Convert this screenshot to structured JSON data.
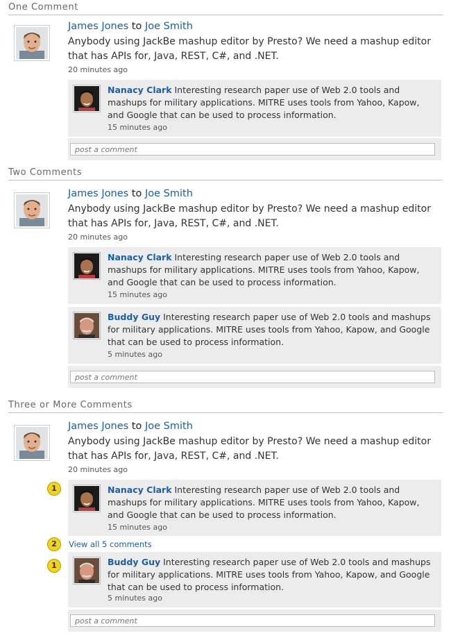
{
  "sections": [
    {
      "title": "One Comment"
    },
    {
      "title": "Two Comments"
    },
    {
      "title": "Three or More Comments"
    }
  ],
  "post": {
    "author": "James Jones",
    "to_word": "to",
    "recipient": "Joe Smith",
    "text": "Anybody using JackBe mashup editor by Presto? We need a mashup editor that has APIs for, Java, REST, C#, and .NET.",
    "time": "20 minutes ago"
  },
  "comments": {
    "nanacy": {
      "name": "Nanacy Clark",
      "text": "Interesting research paper use of Web 2.0 tools and mashups for military applications. MITRE uses tools from Yahoo, Kapow, and Google that can be used to process information.",
      "time": "15 minutes ago"
    },
    "buddy": {
      "name": "Buddy Guy",
      "text": "Interesting research paper use of Web 2.0 tools and mashups for military applications. MITRE uses tools from Yahoo, Kapow, and Google that can be used to process information.",
      "time": "5 minutes ago"
    }
  },
  "comment_box": {
    "placeholder": "post a comment"
  },
  "view_all": "View all 5 comments",
  "markers": {
    "one": "1",
    "two": "2"
  },
  "colors": {
    "link": "#1a5fa6",
    "comment_bg": "#ececec",
    "marker": "#f3d21a"
  }
}
